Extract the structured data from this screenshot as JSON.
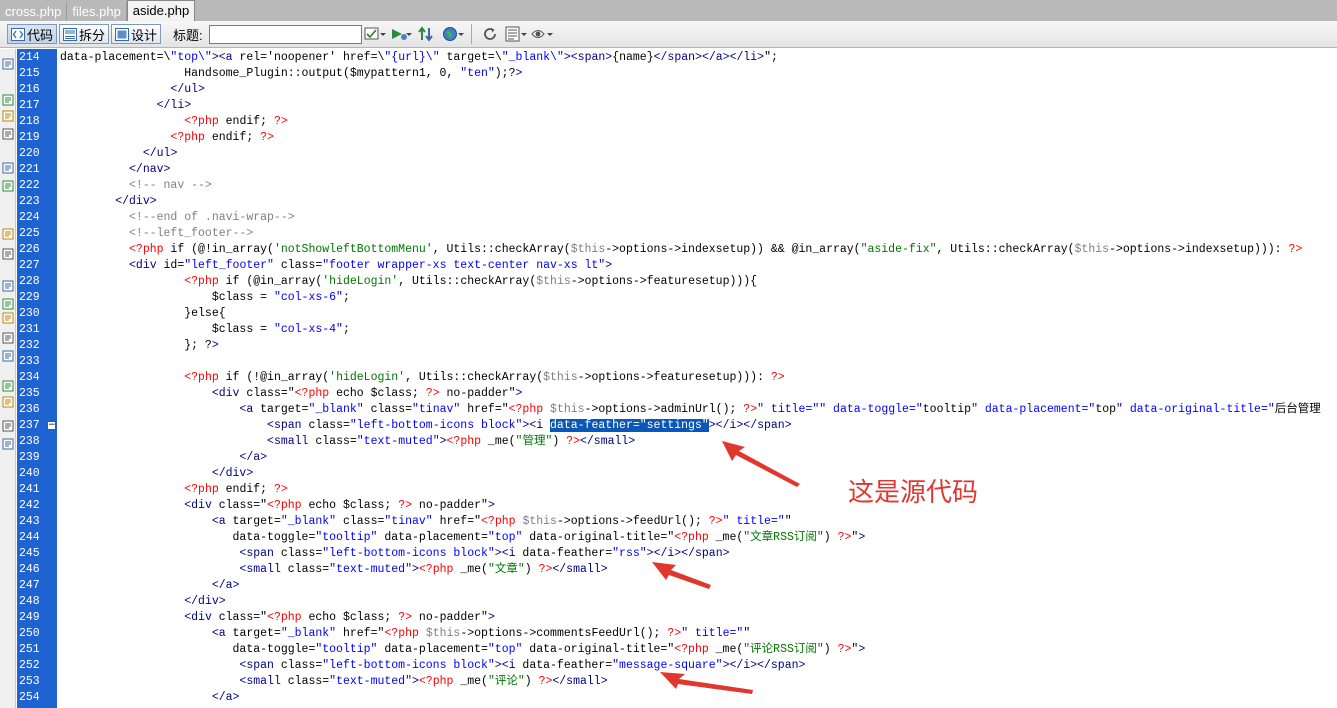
{
  "tabs": [
    {
      "label": "cross.php",
      "active": false
    },
    {
      "label": "files.php",
      "active": false
    },
    {
      "label": "aside.php",
      "active": true
    }
  ],
  "toolbar": {
    "code_label": "代码",
    "split_label": "拆分",
    "design_label": "设计",
    "title_label": "标题:",
    "title_value": ""
  },
  "code_lines": [
    {
      "n": "214",
      "t": "data-placement=\\\"top\\\"><a rel='noopener' href=\\\"{url}\\\" target=\\\"_blank\\\"><span>{name}</span></a></li>\";"
    },
    {
      "n": "215",
      "t": "                  Handsome_Plugin::output($mypattern1, 0, \"ten\");?>"
    },
    {
      "n": "216",
      "t": "                </ul>"
    },
    {
      "n": "217",
      "t": "              </li>"
    },
    {
      "n": "218",
      "t": "                  <?php endif; ?>"
    },
    {
      "n": "219",
      "t": "                <?php endif; ?>"
    },
    {
      "n": "220",
      "t": "            </ul>"
    },
    {
      "n": "221",
      "t": "          </nav>"
    },
    {
      "n": "222",
      "t": "          <!-- nav -->"
    },
    {
      "n": "223",
      "t": "        </div>"
    },
    {
      "n": "224",
      "t": "          <!--end of .navi-wrap-->"
    },
    {
      "n": "225",
      "t": "          <!--left_footer-->"
    },
    {
      "n": "226",
      "t": "          <?php if (@!in_array('notShowleftBottomMenu', Utils::checkArray($this->options->indexsetup)) && @in_array(\"aside-fix\", Utils::checkArray($this->options->indexsetup))): ?>"
    },
    {
      "n": "227",
      "t": "          <div id=\"left_footer\" class=\"footer wrapper-xs text-center nav-xs lt\">"
    },
    {
      "n": "228",
      "t": "                  <?php if (@in_array('hideLogin', Utils::checkArray($this->options->featuresetup))){"
    },
    {
      "n": "229",
      "t": "                      $class = \"col-xs-6\";"
    },
    {
      "n": "230",
      "t": "                  }else{"
    },
    {
      "n": "231",
      "t": "                      $class = \"col-xs-4\";"
    },
    {
      "n": "232",
      "t": "                  }; ?>"
    },
    {
      "n": "233",
      "t": ""
    },
    {
      "n": "234",
      "t": "                  <?php if (!@in_array('hideLogin', Utils::checkArray($this->options->featuresetup))): ?>"
    },
    {
      "n": "235",
      "t": "                      <div class=\"<?php echo $class; ?> no-padder\">"
    },
    {
      "n": "236",
      "t": "                          <a target=\"_blank\" class=\"tinav\" href=\"<?php $this->options->adminUrl(); ?>\" title=\"\" data-toggle=\"tooltip\" data-placement=\"top\" data-original-title=\"后台管理"
    },
    {
      "n": "237",
      "t": "                              <span class=\"left-bottom-icons block\"><i data-feather=\"settings\"></i></span>"
    },
    {
      "n": "238",
      "t": "                              <small class=\"text-muted\"><?php _me(\"管理\") ?></small>"
    },
    {
      "n": "239",
      "t": "                          </a>"
    },
    {
      "n": "240",
      "t": "                      </div>"
    },
    {
      "n": "241",
      "t": "                  <?php endif; ?>"
    },
    {
      "n": "242",
      "t": "                  <div class=\"<?php echo $class; ?> no-padder\">"
    },
    {
      "n": "243",
      "t": "                      <a target=\"_blank\" class=\"tinav\" href=\"<?php $this->options->feedUrl(); ?>\" title=\"\""
    },
    {
      "n": "244",
      "t": "                         data-toggle=\"tooltip\" data-placement=\"top\" data-original-title=\"<?php _me(\"文章RSS订阅\") ?>\">"
    },
    {
      "n": "245",
      "t": "                          <span class=\"left-bottom-icons block\"><i data-feather=\"rss\"></i></span>"
    },
    {
      "n": "246",
      "t": "                          <small class=\"text-muted\"><?php _me(\"文章\") ?></small>"
    },
    {
      "n": "247",
      "t": "                      </a>"
    },
    {
      "n": "248",
      "t": "                  </div>"
    },
    {
      "n": "249",
      "t": "                  <div class=\"<?php echo $class; ?> no-padder\">"
    },
    {
      "n": "250",
      "t": "                      <a target=\"_blank\" href=\"<?php $this->options->commentsFeedUrl(); ?>\" title=\"\""
    },
    {
      "n": "251",
      "t": "                         data-toggle=\"tooltip\" data-placement=\"top\" data-original-title=\"<?php _me(\"评论RSS订阅\") ?>\">"
    },
    {
      "n": "252",
      "t": "                          <span class=\"left-bottom-icons block\"><i data-feather=\"message-square\"></i></span>"
    },
    {
      "n": "253",
      "t": "                          <small class=\"text-muted\"><?php _me(\"评论\") ?></small>"
    },
    {
      "n": "254",
      "t": "                      </a>"
    }
  ],
  "selected_text": "data-feather=\"settings\"",
  "annotation": "这是源代码",
  "colors": {
    "gutter": "#1f63d2",
    "annotation": "#e0372f",
    "selection": "#0a57b8"
  }
}
